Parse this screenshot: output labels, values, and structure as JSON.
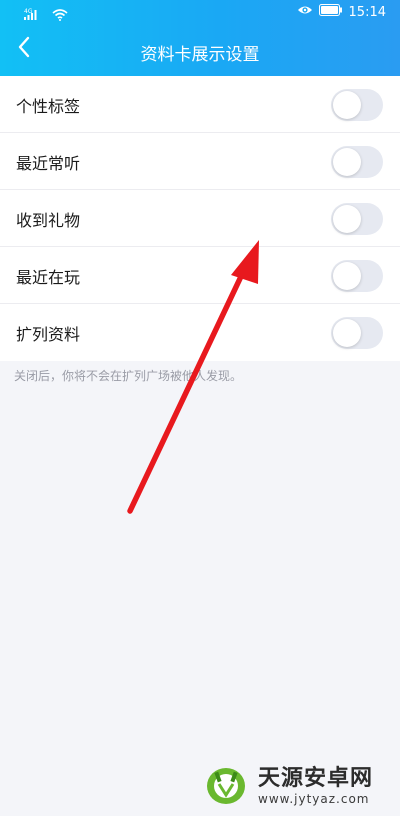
{
  "status_bar": {
    "signal_label": "4G",
    "time": "15:14"
  },
  "header": {
    "title": "资料卡展示设置"
  },
  "settings": [
    {
      "label": "个性标签",
      "enabled": false
    },
    {
      "label": "最近常听",
      "enabled": false
    },
    {
      "label": "收到礼物",
      "enabled": false
    },
    {
      "label": "最近在玩",
      "enabled": false
    },
    {
      "label": "扩列资料",
      "enabled": false
    }
  ],
  "hint_text": "关闭后，你将不会在扩列广场被他人发现。",
  "watermark": {
    "name": "天源安卓网",
    "url": "www.jytyaz.com"
  },
  "colors": {
    "header_start": "#12c0f5",
    "header_end": "#2a9cf2",
    "toggle_off": "#e6e9f1",
    "annotation_arrow": "#e8191e"
  },
  "icons": {
    "back": "chevron-left-icon",
    "signal": "signal-icon",
    "wifi": "wifi-icon",
    "eye": "eye-icon",
    "battery": "battery-icon"
  }
}
